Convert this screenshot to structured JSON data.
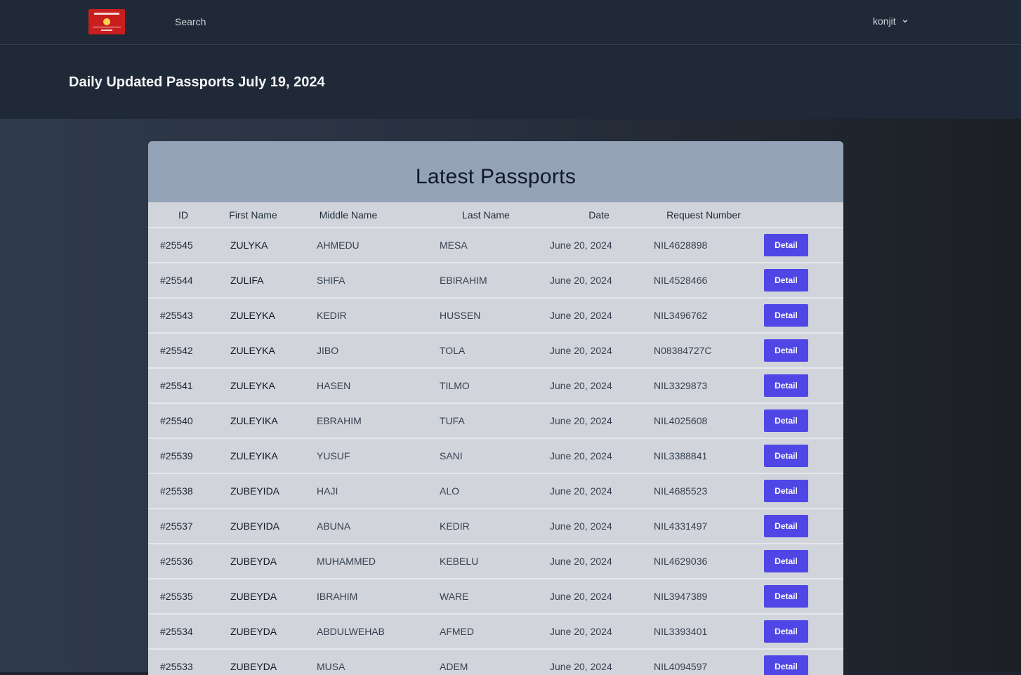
{
  "nav": {
    "search_label": "Search",
    "username": "konjit"
  },
  "header": {
    "title": "Daily Updated Passports July 19, 2024"
  },
  "card": {
    "title": "Latest Passports"
  },
  "colors": {
    "accent": "#4f46e5",
    "nav_bg": "#1f2937",
    "card_header_bg": "#94a3b8",
    "table_bg": "#d1d5db"
  },
  "table": {
    "columns": [
      "ID",
      "First Name",
      "Middle Name",
      "Last Name",
      "Date",
      "Request Number",
      ""
    ],
    "button_label": "Detail",
    "rows": [
      [
        "#25545",
        "ZULYKA",
        "AHMEDU",
        "MESA",
        "June 20, 2024",
        "NIL4628898"
      ],
      [
        "#25544",
        "ZULIFA",
        "SHIFA",
        "EBIRAHIM",
        "June 20, 2024",
        "NIL4528466"
      ],
      [
        "#25543",
        "ZULEYKA",
        "KEDIR",
        "HUSSEN",
        "June 20, 2024",
        "NIL3496762"
      ],
      [
        "#25542",
        "ZULEYKA",
        "JIBO",
        "TOLA",
        "June 20, 2024",
        "N08384727C"
      ],
      [
        "#25541",
        "ZULEYKA",
        "HASEN",
        "TILMO",
        "June 20, 2024",
        "NIL3329873"
      ],
      [
        "#25540",
        "ZULEYIKA",
        "EBRAHIM",
        "TUFA",
        "June 20, 2024",
        "NIL4025608"
      ],
      [
        "#25539",
        "ZULEYIKA",
        "YUSUF",
        "SANI",
        "June 20, 2024",
        "NIL3388841"
      ],
      [
        "#25538",
        "ZUBEYIDA",
        "HAJI",
        "ALO",
        "June 20, 2024",
        "NIL4685523"
      ],
      [
        "#25537",
        "ZUBEYIDA",
        "ABUNA",
        "KEDIR",
        "June 20, 2024",
        "NIL4331497"
      ],
      [
        "#25536",
        "ZUBEYDA",
        "MUHAMMED",
        "KEBELU",
        "June 20, 2024",
        "NIL4629036"
      ],
      [
        "#25535",
        "ZUBEYDA",
        "IBRAHIM",
        "WARE",
        "June 20, 2024",
        "NIL3947389"
      ],
      [
        "#25534",
        "ZUBEYDA",
        "ABDULWEHAB",
        "AFMED",
        "June 20, 2024",
        "NIL3393401"
      ],
      [
        "#25533",
        "ZUBEYDA",
        "MUSA",
        "ADEM",
        "June 20, 2024",
        "NIL4094597"
      ]
    ]
  }
}
